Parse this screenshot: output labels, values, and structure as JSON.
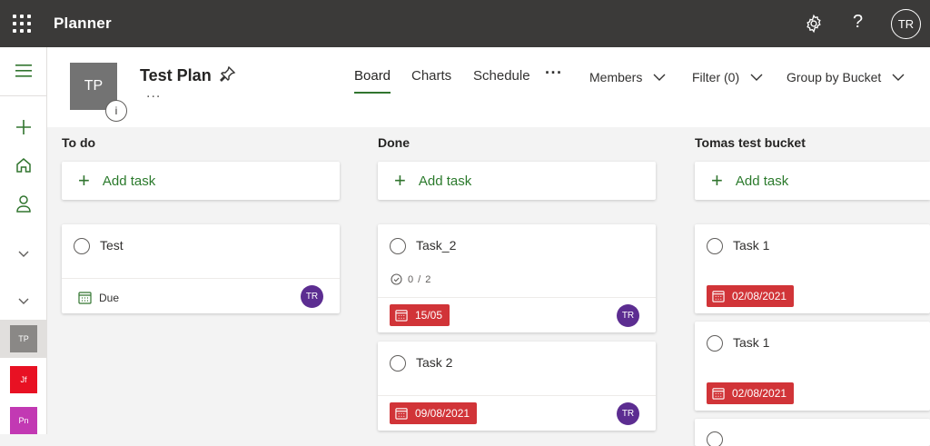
{
  "app": {
    "title": "Planner",
    "user_initials": "TR"
  },
  "rail": {
    "plans": [
      {
        "initials": "TP",
        "color": "#8a8886"
      },
      {
        "initials": "Jf",
        "color": "#e81123"
      },
      {
        "initials": "Pn",
        "color": "#c239b3"
      }
    ]
  },
  "plan": {
    "initials": "TP",
    "name": "Test Plan",
    "more": "...",
    "info": "i"
  },
  "tabs": [
    {
      "label": "Board",
      "active": true
    },
    {
      "label": "Charts",
      "active": false
    },
    {
      "label": "Schedule",
      "active": false
    }
  ],
  "tabs_more": "···",
  "controls": {
    "members": "Members",
    "filter": "Filter (0)",
    "group": "Group by Bucket"
  },
  "colors": {
    "accent": "#31752f",
    "late": "#d13438",
    "avatar": "#5c2d91",
    "topbar": "#3b3a39"
  },
  "buckets": [
    {
      "title": "To do",
      "add_label": "Add task",
      "tasks": [
        {
          "name": "Test",
          "due_label": "Due",
          "assignee": "TR"
        }
      ]
    },
    {
      "title": "Done",
      "add_label": "Add task",
      "tasks": [
        {
          "name": "Task_2",
          "checklist": "0 / 2",
          "date": "15/05",
          "assignee": "TR"
        },
        {
          "name": "Task 2",
          "date": "09/08/2021",
          "assignee": "TR"
        }
      ]
    },
    {
      "title": "Tomas test bucket",
      "add_label": "Add task",
      "tasks": [
        {
          "name": "Task 1",
          "date": "02/08/2021"
        },
        {
          "name": "Task 1",
          "date": "02/08/2021"
        }
      ]
    }
  ]
}
